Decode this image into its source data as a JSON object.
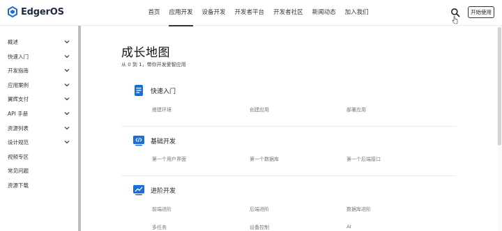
{
  "header": {
    "logo_text": "EdgerOS",
    "nav": [
      "首页",
      "应用开发",
      "设备开发",
      "开发者平台",
      "开发者社区",
      "新闻动态",
      "加入我们"
    ],
    "active_nav": "应用开发",
    "start_button": "开始使用"
  },
  "sidebar": {
    "items": [
      {
        "label": "概述",
        "expandable": true
      },
      {
        "label": "快速入门",
        "expandable": true
      },
      {
        "label": "开发指南",
        "expandable": true
      },
      {
        "label": "应用案例",
        "expandable": true
      },
      {
        "label": "翼辉支付",
        "expandable": true
      },
      {
        "label": "API 手册",
        "expandable": true
      },
      {
        "label": "资源列表",
        "expandable": true
      },
      {
        "label": "设计规范",
        "expandable": true
      },
      {
        "label": "视频专区",
        "expandable": false
      },
      {
        "label": "常见问题",
        "expandable": false
      },
      {
        "label": "资源下载",
        "expandable": false
      }
    ]
  },
  "main": {
    "title": "成长地图",
    "subtitle": "从 0 到 1，带你开发爱智应用",
    "sections": [
      {
        "title": "快速入门",
        "icon": "document-icon",
        "links": [
          "搭建环境",
          "创建应用",
          "部署应用"
        ]
      },
      {
        "title": "基础开发",
        "icon": "code-icon",
        "links": [
          "第一个用户界面",
          "第一个数据库",
          "第一个后端接口"
        ]
      },
      {
        "title": "进阶开发",
        "icon": "chart-icon",
        "links": [
          "前端进阶",
          "后端进阶",
          "数据库进阶",
          "多任务",
          "设备控制",
          "AI"
        ]
      }
    ]
  },
  "colors": {
    "accent": "#1a6fd6",
    "text": "#222222",
    "muted": "#777777"
  }
}
